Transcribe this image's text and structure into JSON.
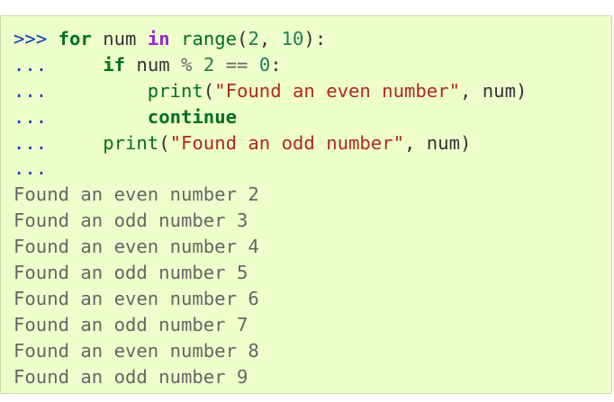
{
  "code": {
    "prompt_primary": ">>>",
    "prompt_secondary": "...",
    "lines": [
      {
        "prompt": ">>>",
        "indent": " ",
        "tokens": [
          {
            "t": "kw",
            "v": "for"
          },
          {
            "t": "pn",
            "v": " num "
          },
          {
            "t": "ow",
            "v": "in"
          },
          {
            "t": "pn",
            "v": " "
          },
          {
            "t": "bi",
            "v": "range"
          },
          {
            "t": "pn",
            "v": "("
          },
          {
            "t": "num",
            "v": "2"
          },
          {
            "t": "pn",
            "v": ", "
          },
          {
            "t": "num",
            "v": "10"
          },
          {
            "t": "pn",
            "v": "):"
          }
        ]
      },
      {
        "prompt": "...",
        "indent": "     ",
        "tokens": [
          {
            "t": "kw",
            "v": "if"
          },
          {
            "t": "pn",
            "v": " num "
          },
          {
            "t": "op",
            "v": "%"
          },
          {
            "t": "pn",
            "v": " "
          },
          {
            "t": "num",
            "v": "2"
          },
          {
            "t": "pn",
            "v": " "
          },
          {
            "t": "op",
            "v": "=="
          },
          {
            "t": "pn",
            "v": " "
          },
          {
            "t": "num",
            "v": "0"
          },
          {
            "t": "pn",
            "v": ":"
          }
        ]
      },
      {
        "prompt": "...",
        "indent": "         ",
        "tokens": [
          {
            "t": "bi",
            "v": "print"
          },
          {
            "t": "pn",
            "v": "("
          },
          {
            "t": "str",
            "v": "\"Found an even number\""
          },
          {
            "t": "pn",
            "v": ", num)"
          }
        ]
      },
      {
        "prompt": "...",
        "indent": "         ",
        "tokens": [
          {
            "t": "kw",
            "v": "continue"
          }
        ]
      },
      {
        "prompt": "...",
        "indent": "     ",
        "tokens": [
          {
            "t": "bi",
            "v": "print"
          },
          {
            "t": "pn",
            "v": "("
          },
          {
            "t": "str",
            "v": "\"Found an odd number\""
          },
          {
            "t": "pn",
            "v": ", num)"
          }
        ]
      },
      {
        "prompt": "...",
        "indent": "",
        "tokens": []
      }
    ],
    "output": [
      "Found an even number 2",
      "Found an odd number 3",
      "Found an even number 4",
      "Found an odd number 5",
      "Found an even number 6",
      "Found an odd number 7",
      "Found an even number 8",
      "Found an odd number 9"
    ]
  },
  "colors": {
    "background": "#eeffcc",
    "border": "#c6dba6",
    "prompt": "#0b3cb8",
    "keyword": "#007020",
    "operator_word": "#9c27d8",
    "string": "#b0291f",
    "number": "#208050",
    "output": "#666666"
  }
}
